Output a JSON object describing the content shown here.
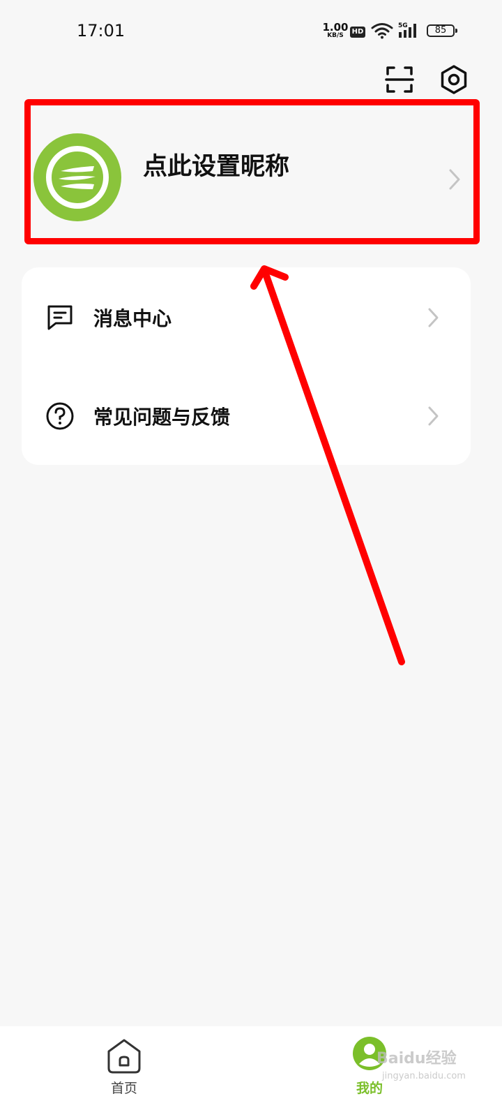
{
  "status_bar": {
    "time": "17:01",
    "net_speed_value": "1.00",
    "net_speed_unit": "KB/S",
    "hd_badge": "HD",
    "network_type": "5G",
    "battery": "85"
  },
  "toolbar": {
    "icons": [
      "scan-icon",
      "settings-icon"
    ]
  },
  "profile": {
    "nickname_prompt": "点此设置昵称",
    "avatar_color": "#8ac43b"
  },
  "menu": {
    "items": [
      {
        "label": "消息中心",
        "icon": "message-icon"
      },
      {
        "label": "常见问题与反馈",
        "icon": "question-icon"
      }
    ]
  },
  "bottom_nav": {
    "home_label": "首页",
    "me_label": "我的",
    "active_color": "#7bbf2a"
  },
  "annotation": {
    "color": "#ff0000"
  },
  "watermark": {
    "text": "Baidu经验",
    "url": "jingyan.baidu.com"
  }
}
